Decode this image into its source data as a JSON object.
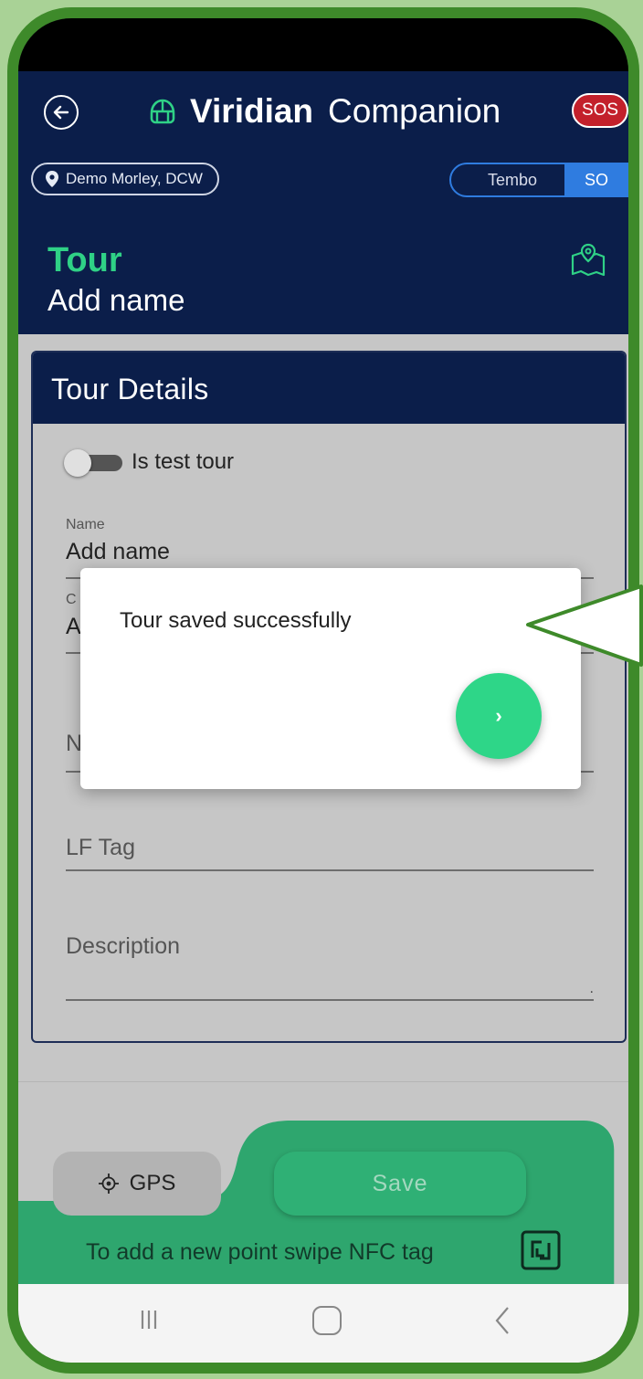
{
  "app": {
    "brand_name": "Viridian",
    "brand_sub": "Companion",
    "sos_label": "SOS",
    "location": "Demo Morley, DCW",
    "toggle": {
      "option1": "Tembo",
      "option2": "SO",
      "selected": "SO"
    },
    "page_title": "Tour",
    "page_subtitle": "Add name"
  },
  "card": {
    "header": "Tour Details",
    "test_tour_label": "Is test tour",
    "test_tour_on": false,
    "name_label": "Name",
    "name_value": "Add name",
    "partial_label_2": "C",
    "partial_value_2": "A",
    "partial_value_3": "N",
    "lf_tag_placeholder": "LF Tag",
    "description_placeholder": "Description",
    "description_dot": "."
  },
  "bottom": {
    "gps_label": "GPS",
    "save_label": "Save",
    "nfc_hint": "To add a new point swipe NFC tag"
  },
  "dialog": {
    "message": "Tour saved successfully",
    "next_glyph": "›"
  },
  "colors": {
    "navy": "#0b1e4a",
    "accent_green": "#2fd186",
    "save_green": "#2fb075",
    "sos_red": "#c3202b",
    "toggle_blue": "#2f7ce0",
    "frame_green": "#3e8a2a"
  },
  "icons": {
    "back": "arrow-left-icon",
    "brand": "helmet-icon",
    "location": "map-pin-icon",
    "map": "map-location-icon",
    "gps": "crosshair-icon",
    "nfc": "nfc-icon",
    "next": "chevron-right-icon"
  }
}
